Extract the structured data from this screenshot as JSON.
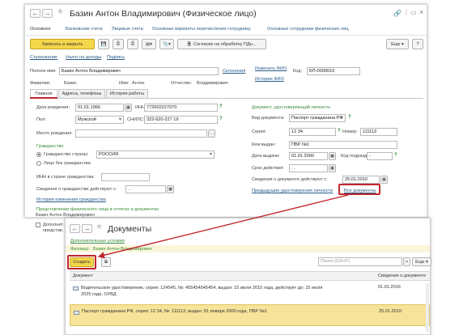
{
  "form": {
    "title": "Базин Антон Владимирович (Физическое лицо)",
    "tabs": [
      "Основное",
      "Банковские счета",
      "Лицевые счета",
      "Основные варианты перечисления сотруднику",
      "Основные сотрудники физических лиц"
    ],
    "toolbar": {
      "save_close": "Записать и закрыть",
      "consent": "Согласие на обработку ПДн...",
      "more": "Еще"
    },
    "links": [
      "Страхование",
      "Налог на доходы",
      "Подпись"
    ],
    "full_name_label": "Полное имя:",
    "full_name_value": "Базин Антон Владимирович",
    "declensions_link": "Склонения",
    "change_fio_link": "Изменить ФИО",
    "fio_history_link": "История ФИО",
    "code_label": "Код:",
    "code_value": "БП-0000010",
    "surname_label": "Фамилия:",
    "surname_value": "Базин",
    "name_label": "Имя:",
    "name_value": "Антон",
    "patronymic_label": "Отчество:",
    "patronymic_value": "Владимирович",
    "subtabs": [
      "Главное",
      "Адреса, телефоны",
      "История работы"
    ],
    "birth_label": "Дата рождения:",
    "birth_value": "01.01.1966",
    "inn_label": "ИНН:",
    "inn_value": "772602227070",
    "sex_label": "Пол:",
    "sex_value": "Мужской",
    "snils_label": "СНИЛС:",
    "snils_value": "322-620-227 19",
    "birthplace_label": "Место рождения:",
    "citizenship_header": "Гражданство",
    "country_radio": "Гражданство страны:",
    "country_value": "РОССИЯ",
    "stateless_radio": "Лицо без гражданства",
    "inn_country_label": "ИНН в стране гражданства:",
    "citizenship_valid_label": "Сведения о гражданстве действуют с:",
    "citizenship_valid_value": ". .",
    "citizenship_history_link": "История изменения гражданства",
    "representation_header": "Представление физического лица в отчетах и документах",
    "representation_value": "Базин Антон Владимирович",
    "extra_checkbox": "Дополнит... представ...",
    "doc_header": "Документ, удостоверяющий личность",
    "doctype_label": "Вид документа:",
    "doctype_value": "Паспорт гражданина РФ",
    "series_label": "Серия:",
    "series_value": "12 34",
    "number_label": "Номер:",
    "number_value": "111113",
    "issued_by_label": "Кем выдан:",
    "issued_by_value": "ПВР №1",
    "issue_date_label": "Дата выдачи:",
    "issue_date_value": "01.01.2000",
    "dept_code_label": "Код подразд.:",
    "dept_code_value": "-",
    "validity_label": "Срок действия:",
    "validity_value": ". .",
    "doc_valid_label": "Сведения о документе действуют с:",
    "doc_valid_value": "25.01.2010",
    "prev_docs_link": "Предыдущие удостоверения личности",
    "all_docs_link": "Все документы"
  },
  "docs": {
    "title": "Документы",
    "extra_conditions_link": "Дополнительные условия",
    "filter_label": "Физлицо:",
    "filter_value": "Базин Антон Владимирович",
    "create_button": "Создать",
    "search_placeholder": "Поиск (Ctrl+F)",
    "more_button": "Еще",
    "columns": [
      "Документ",
      "Сведения о документе"
    ],
    "rows": [
      {
        "text": "Водительское удостоверение, серия: 124545, №: 455454545454, выдан: 15 июля 2015 года, действует до: 15 июля 2025 года, ОУВД",
        "date": "01.01.2016"
      },
      {
        "text": "Паспорт гражданина РФ, серия: 12 34, №: 111113, выдан: 01 января 2000 года, ПВР №1",
        "date": "25.01.2010"
      }
    ]
  },
  "colors": {
    "accent_yellow": "#f4d64b",
    "highlight_red": "#c1272d",
    "link_blue": "#2a5c8a",
    "green_section": "#3a8a3a",
    "selected_row": "#f7e39a"
  }
}
